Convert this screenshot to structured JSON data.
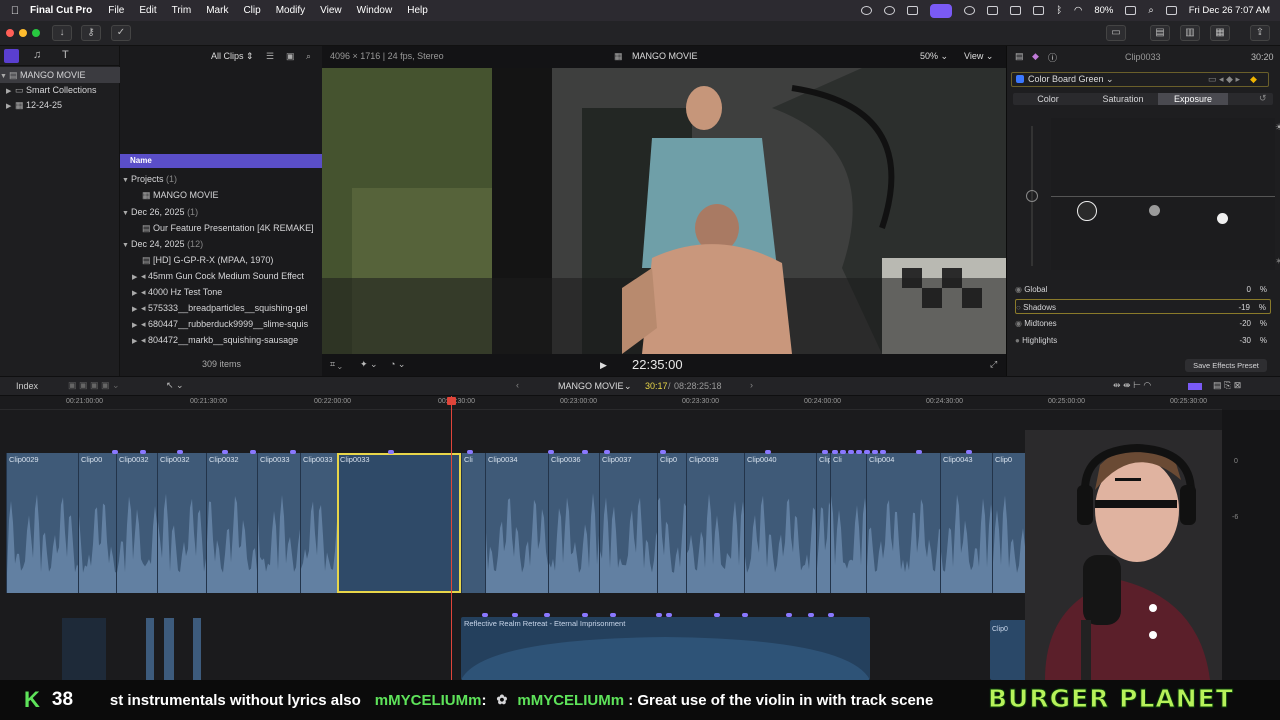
{
  "menubar": {
    "apple": "",
    "app": "Final Cut Pro",
    "menus": [
      "File",
      "Edit",
      "Trim",
      "Mark",
      "Clip",
      "Modify",
      "View",
      "Window",
      "Help"
    ],
    "battery": "80%",
    "datetime": "Fri Dec 26  7:07 AM"
  },
  "browser": {
    "filter": "All Clips",
    "format": "4096 × 1716 | 24 fps, Stereo",
    "column_name": "Name",
    "item_count": "309 items",
    "rows": [
      {
        "label": "Projects",
        "count": "(1)",
        "kind": "group"
      },
      {
        "label": "MANGO MOVIE",
        "kind": "project"
      },
      {
        "label": "Dec 26, 2025",
        "count": "(1)",
        "kind": "group"
      },
      {
        "label": "Our Feature Presentation [4K REMAKE]",
        "kind": "clip"
      },
      {
        "label": "Dec 24, 2025",
        "count": "(12)",
        "kind": "group"
      },
      {
        "label": "[HD] G-GP-R-X (MPAA, 1970)",
        "kind": "clip"
      },
      {
        "label": "45mm Gun Cock Medium Sound Effect",
        "kind": "audio"
      },
      {
        "label": "4000 Hz Test Tone",
        "kind": "audio"
      },
      {
        "label": "575333__breadparticles__squishing-gel",
        "kind": "audio"
      },
      {
        "label": "680447__rubberduck9999__slime-squis",
        "kind": "audio"
      },
      {
        "label": "804472__markb__squishing-sausage",
        "kind": "audio"
      }
    ]
  },
  "library": {
    "name": "MANGO MOVIE",
    "items": [
      "Smart Collections",
      "12-24-25"
    ]
  },
  "viewer": {
    "title": "MANGO MOVIE",
    "zoom": "50%",
    "view_label": "View",
    "timecode": "22:35:00"
  },
  "inspector": {
    "clip_name": "Clip0033",
    "duration": "30:20",
    "effect": "Color Board Green",
    "tabs": [
      "Color",
      "Saturation",
      "Exposure"
    ],
    "controls": [
      {
        "label": "Global",
        "value": "0"
      },
      {
        "label": "Shadows",
        "value": "-19"
      },
      {
        "label": "Midtones",
        "value": "-20"
      },
      {
        "label": "Highlights",
        "value": "-30"
      }
    ],
    "pct": "%",
    "save_button": "Save Effects Preset"
  },
  "timeline": {
    "index": "Index",
    "project": "MANGO MOVIE",
    "position": "30:17",
    "total": "08:28:25:18",
    "ruler": [
      "00:21:00:00",
      "00:21:30:00",
      "00:22:00:00",
      "00:22:30:00",
      "00:23:00:00",
      "00:23:30:00",
      "00:24:00:00",
      "00:24:30:00",
      "00:25:00:00",
      "00:25:30:00"
    ],
    "clips": [
      "Clip0029",
      "Clip00",
      "Clip0032",
      "Clip0032",
      "Clip0032",
      "Clip0033",
      "Clip0033",
      "Clip0033",
      "Cli",
      "Clip0034",
      "Clip0036",
      "Clip0037",
      "Clip0",
      "Clip0039",
      "Clip0040",
      "Clip004",
      "Cli",
      "Clip004",
      "Clip0043",
      "Clip0",
      "Cli",
      "Clip0"
    ],
    "music": "Reflective Realm Retreat - Eternal Imprisonment",
    "music_clip2": "Clip0",
    "meter": [
      "0",
      "-6"
    ]
  },
  "stream": {
    "k": "K",
    "count": "38",
    "ticker_text": "st instrumentals without lyrics also",
    "user1": "mMYCELIUMm",
    "sep1": " : ",
    "user2": "mMYCELIUMm",
    "message": "Great use of the violin in with track scene",
    "sponsor": "BURGER PLANET"
  },
  "colors": {
    "accent": "#7a5af5",
    "selection": "#e8d64a",
    "clip": "#3f5a78",
    "playhead": "#e0453a",
    "chat_green": "#5ee35a"
  }
}
